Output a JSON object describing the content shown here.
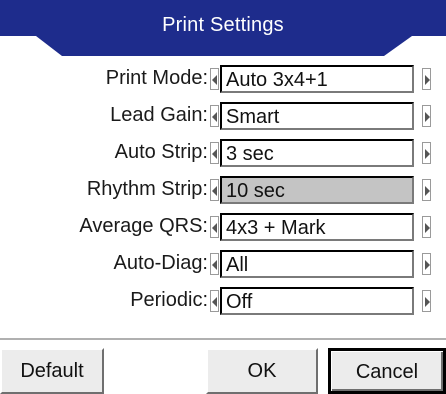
{
  "dialog": {
    "title": "Print Settings",
    "accent": "#1e2c8c"
  },
  "settings": [
    {
      "label": "Print Mode:",
      "value": "Auto 3x4+1",
      "selected": false
    },
    {
      "label": "Lead Gain:",
      "value": "Smart",
      "selected": false
    },
    {
      "label": "Auto Strip:",
      "value": "3 sec",
      "selected": false
    },
    {
      "label": "Rhythm Strip:",
      "value": "10 sec",
      "selected": true
    },
    {
      "label": "Average QRS:",
      "value": "4x3 + Mark",
      "selected": false
    },
    {
      "label": "Auto-Diag:",
      "value": "All",
      "selected": false
    },
    {
      "label": "Periodic:",
      "value": "Off",
      "selected": false
    }
  ],
  "buttons": {
    "default": "Default",
    "ok": "OK",
    "cancel": "Cancel"
  },
  "icons": {
    "left": "arrow-left-icon",
    "right": "arrow-right-icon"
  }
}
